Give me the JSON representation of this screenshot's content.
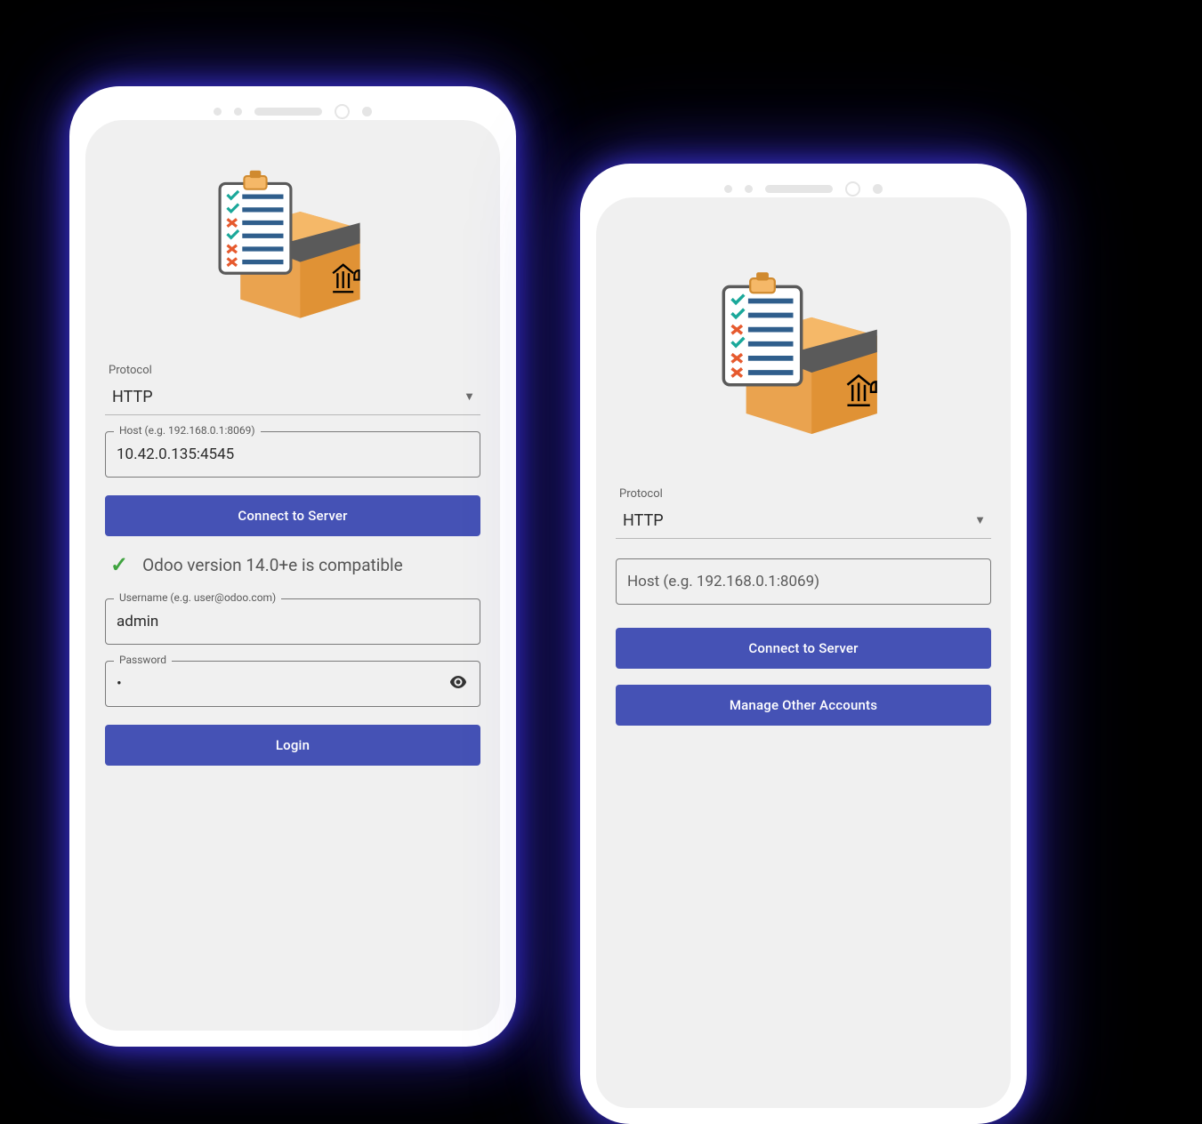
{
  "left": {
    "protocol_label": "Protocol",
    "protocol_value": "HTTP",
    "host_label": "Host (e.g. 192.168.0.1:8069)",
    "host_value": "10.42.0.135:4545",
    "connect_button": "Connect to Server",
    "compat_message": "Odoo version 14.0+e is compatible",
    "username_label": "Username (e.g. user@odoo.com)",
    "username_value": "admin",
    "password_label": "Password",
    "password_value": "•",
    "login_button": "Login"
  },
  "right": {
    "protocol_label": "Protocol",
    "protocol_value": "HTTP",
    "host_placeholder": "Host (e.g. 192.168.0.1:8069)",
    "connect_button": "Connect to Server",
    "manage_button": "Manage Other Accounts"
  }
}
